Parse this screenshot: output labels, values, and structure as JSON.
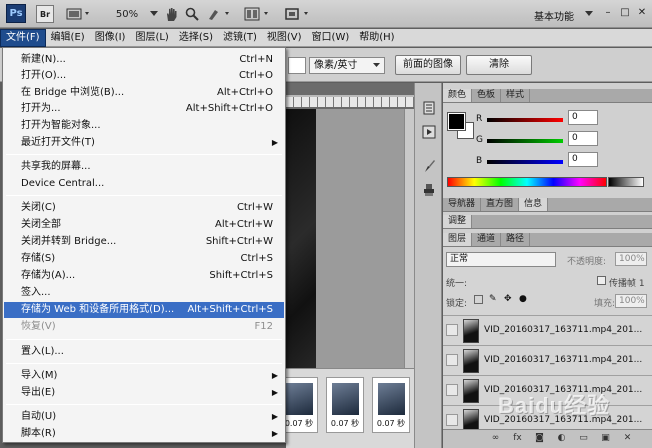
{
  "appbar": {
    "logo": "Ps",
    "bridge": "Br",
    "zoom": "50%",
    "workspace": "基本功能",
    "window_controls": [
      "–",
      "□",
      "✕"
    ]
  },
  "menubar": {
    "items": [
      {
        "label": "文件(F)"
      },
      {
        "label": "编辑(E)"
      },
      {
        "label": "图像(I)"
      },
      {
        "label": "图层(L)"
      },
      {
        "label": "选择(S)"
      },
      {
        "label": "滤镜(T)"
      },
      {
        "label": "视图(V)"
      },
      {
        "label": "窗口(W)"
      },
      {
        "label": "帮助(H)"
      }
    ]
  },
  "options": {
    "unit": "像素/英寸",
    "front_image": "前面的图像",
    "clear": "清除"
  },
  "file_menu": {
    "items": [
      {
        "label": "新建(N)...",
        "shortcut": "Ctrl+N"
      },
      {
        "label": "打开(O)...",
        "shortcut": "Ctrl+O"
      },
      {
        "label": "在 Bridge 中浏览(B)...",
        "shortcut": "Alt+Ctrl+O"
      },
      {
        "label": "打开为...",
        "shortcut": "Alt+Shift+Ctrl+O"
      },
      {
        "label": "打开为智能对象...",
        "shortcut": ""
      },
      {
        "label": "最近打开文件(T)",
        "shortcut": ""
      },
      {
        "label": "共享我的屏幕...",
        "shortcut": ""
      },
      {
        "label": "Device Central...",
        "shortcut": ""
      },
      {
        "label": "关闭(C)",
        "shortcut": "Ctrl+W"
      },
      {
        "label": "关闭全部",
        "shortcut": "Alt+Ctrl+W"
      },
      {
        "label": "关闭并转到 Bridge...",
        "shortcut": "Shift+Ctrl+W"
      },
      {
        "label": "存储(S)",
        "shortcut": "Ctrl+S"
      },
      {
        "label": "存储为(A)...",
        "shortcut": "Shift+Ctrl+S"
      },
      {
        "label": "签入...",
        "shortcut": ""
      },
      {
        "label": "存储为 Web 和设备所用格式(D)...",
        "shortcut": "Alt+Shift+Ctrl+S"
      },
      {
        "label": "恢复(V)",
        "shortcut": "F12"
      },
      {
        "label": "置入(L)...",
        "shortcut": ""
      },
      {
        "label": "导入(M)",
        "shortcut": ""
      },
      {
        "label": "导出(E)",
        "shortcut": ""
      },
      {
        "label": "自动(U)",
        "shortcut": ""
      },
      {
        "label": "脚本(R)",
        "shortcut": ""
      }
    ]
  },
  "frames": {
    "delays": [
      "0.07 秒",
      "0.07 秒",
      "0.07 秒"
    ]
  },
  "color_panel": {
    "tabs": [
      "颜色",
      "色板",
      "样式"
    ],
    "r_label": "R",
    "g_label": "G",
    "b_label": "B",
    "r": "0",
    "g": "0",
    "b": "0"
  },
  "nav_panel": {
    "tabs": [
      "导航器",
      "直方图",
      "信息"
    ]
  },
  "adjust_panel": {
    "tab": "调整"
  },
  "layers_panel": {
    "tabs": [
      "图层",
      "通道",
      "路径"
    ],
    "blend_mode": "正常",
    "opacity_label": "不透明度:",
    "opacity": "100%",
    "unify_label": "统一:",
    "propagate_label": "传播帧 1",
    "lock_label": "锁定:",
    "fill_label": "填充:",
    "fill": "100%",
    "layers": [
      {
        "name": "VID_20160317_163711.mp4_201..."
      },
      {
        "name": "VID_20160317_163711.mp4_201..."
      },
      {
        "name": "VID_20160317_163711.mp4_201..."
      },
      {
        "name": "VID_20160317_163711.mp4_201..."
      }
    ]
  },
  "watermark": "Baidu经验"
}
